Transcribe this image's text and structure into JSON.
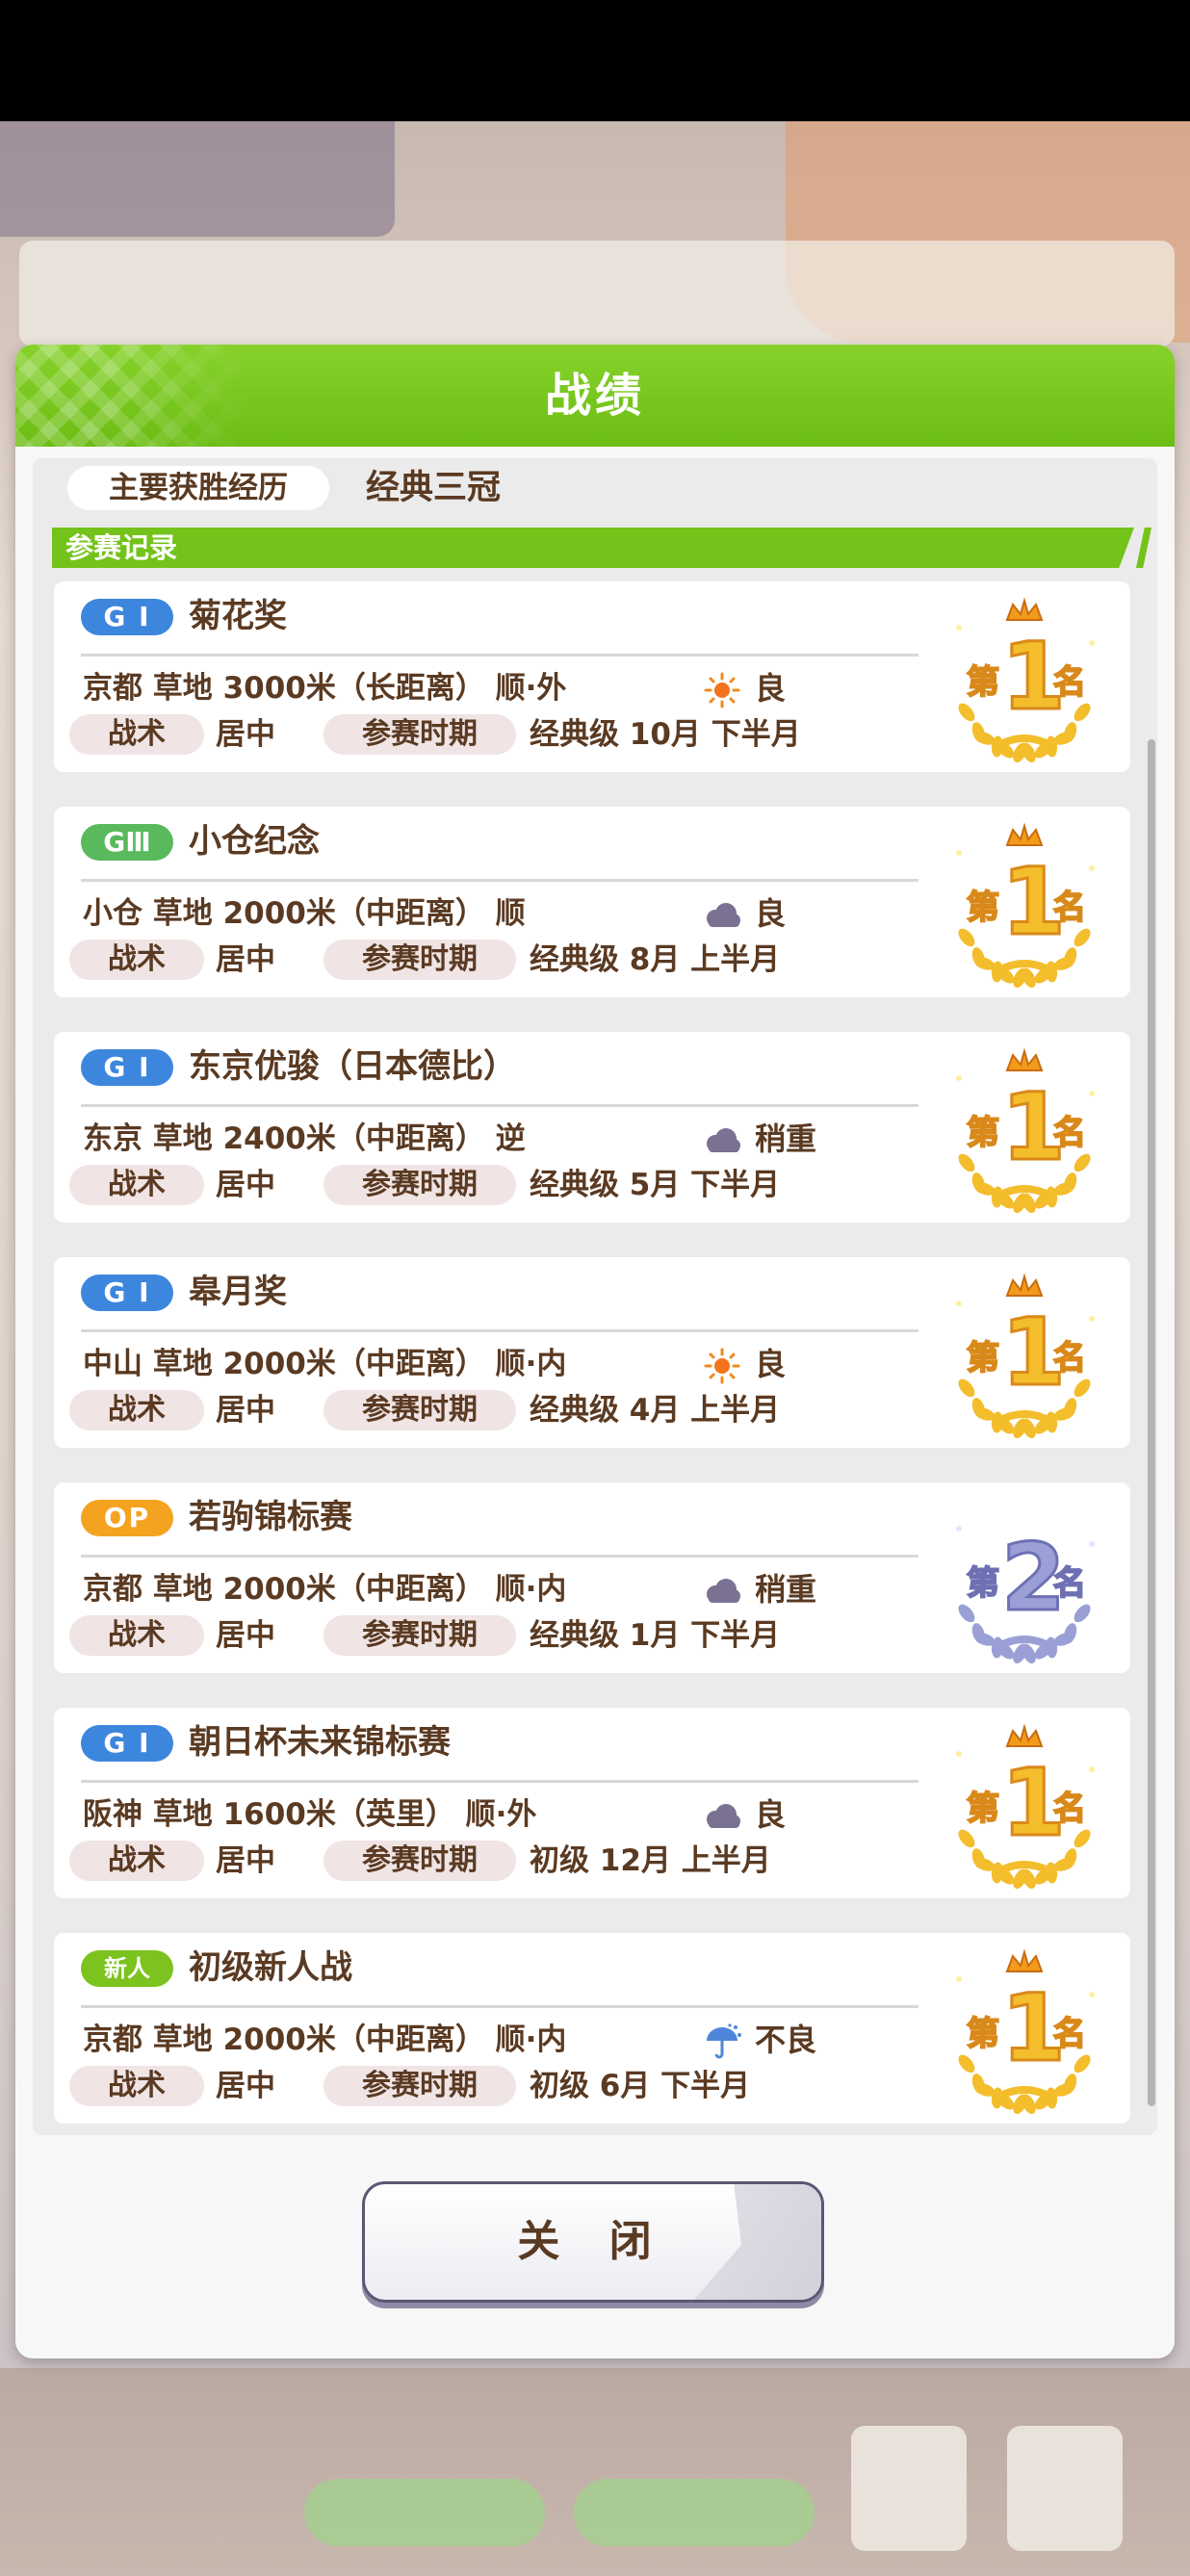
{
  "dialog": {
    "title": "战绩",
    "close_label": "关 闭"
  },
  "summary": {
    "label": "主要获胜经历",
    "value": "经典三冠"
  },
  "section": {
    "title": "参赛记录"
  },
  "labels": {
    "tactic": "战术",
    "period": "参赛时期"
  },
  "colors": {
    "header_green": "#74c31a",
    "g1_blue": "#3d86de",
    "g3_green": "#59b95c",
    "op_orange": "#f4a320",
    "debut_green": "#7cc31f",
    "gold": "#f1b72a",
    "silver": "#8f91c9",
    "text_brown": "#5a3a22"
  },
  "races": [
    {
      "grade": "G I",
      "grade_type": "g1",
      "name": "菊花奖",
      "venue_line": "京都  草地  3000米（长距离）  顺·外",
      "weather_icon": "sun-icon",
      "condition": "良",
      "tactic": "居中",
      "period": "经典级  10月  下半月",
      "place": 1,
      "place_text": {
        "prefix": "第",
        "number": "1",
        "suffix": "名"
      }
    },
    {
      "grade": "GⅢ",
      "grade_type": "g3",
      "name": "小仓纪念",
      "venue_line": "小仓  草地  2000米（中距离）  顺",
      "weather_icon": "cloud-icon",
      "condition": "良",
      "tactic": "居中",
      "period": "经典级  8月  上半月",
      "place": 1,
      "place_text": {
        "prefix": "第",
        "number": "1",
        "suffix": "名"
      }
    },
    {
      "grade": "G I",
      "grade_type": "g1",
      "name": "东京优骏（日本德比）",
      "venue_line": "东京  草地  2400米（中距离）  逆",
      "weather_icon": "cloud-icon",
      "condition": "稍重",
      "tactic": "居中",
      "period": "经典级  5月  下半月",
      "place": 1,
      "place_text": {
        "prefix": "第",
        "number": "1",
        "suffix": "名"
      }
    },
    {
      "grade": "G I",
      "grade_type": "g1",
      "name": "皋月奖",
      "venue_line": "中山  草地  2000米（中距离）  顺·内",
      "weather_icon": "sun-icon",
      "condition": "良",
      "tactic": "居中",
      "period": "经典级  4月  上半月",
      "place": 1,
      "place_text": {
        "prefix": "第",
        "number": "1",
        "suffix": "名"
      }
    },
    {
      "grade": "OP",
      "grade_type": "op",
      "name": "若驹锦标赛",
      "venue_line": "京都  草地  2000米（中距离）  顺·内",
      "weather_icon": "cloud-icon",
      "condition": "稍重",
      "tactic": "居中",
      "period": "经典级  1月  下半月",
      "place": 2,
      "place_text": {
        "prefix": "第",
        "number": "2",
        "suffix": "名"
      }
    },
    {
      "grade": "G I",
      "grade_type": "g1",
      "name": "朝日杯未来锦标赛",
      "venue_line": "阪神  草地  1600米（英里）  顺·外",
      "weather_icon": "cloud-icon",
      "condition": "良",
      "tactic": "居中",
      "period": "初级  12月  上半月",
      "place": 1,
      "place_text": {
        "prefix": "第",
        "number": "1",
        "suffix": "名"
      }
    },
    {
      "grade": "新人",
      "grade_type": "debut",
      "name": "初级新人战",
      "venue_line": "京都  草地  2000米（中距离）  顺·内",
      "weather_icon": "umbrella-icon",
      "condition": "不良",
      "tactic": "居中",
      "period": "初级  6月  下半月",
      "place": 1,
      "place_text": {
        "prefix": "第",
        "number": "1",
        "suffix": "名"
      }
    }
  ]
}
